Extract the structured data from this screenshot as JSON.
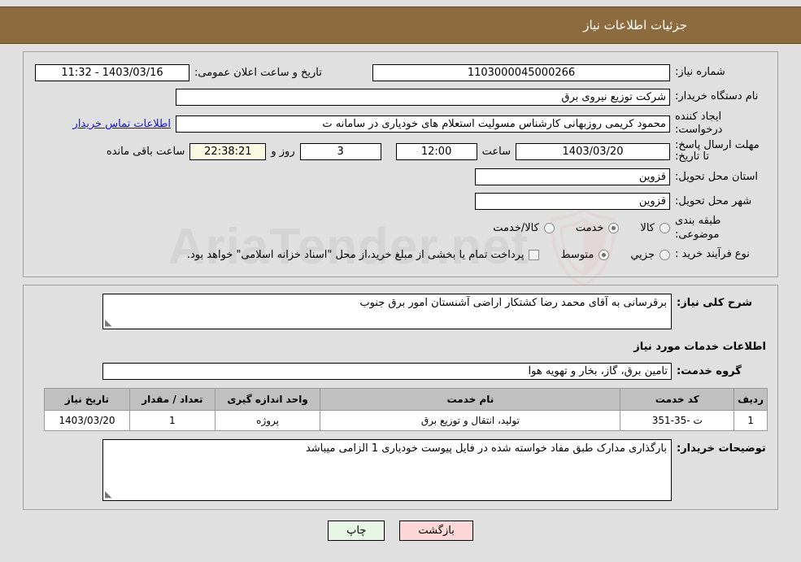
{
  "header": {
    "title": "جزئیات اطلاعات نیاز"
  },
  "form": {
    "need_number_label": "شماره نیاز:",
    "need_number_value": "1103000045000266",
    "announce_label": "تاریخ و ساعت اعلان عمومی:",
    "announce_value": "1403/03/16 - 11:32",
    "buyer_org_label": "نام دستگاه خریدار:",
    "buyer_org_value": "شرکت توزیع نیروی برق",
    "creator_label": "ایجاد کننده درخواست:",
    "creator_value": "محمود کریمی روزبهانی کارشناس  مسولیت استعلام های خودیاری در سامانه ت",
    "contact_link": "اطلاعات تماس خریدار",
    "deadline_label": "مهلت ارسال پاسخ: تا تاریخ:",
    "deadline_date": "1403/03/20",
    "hour_label": "ساعت",
    "hour_value": "12:00",
    "days_value": "3",
    "days_label": "روز و",
    "countdown_value": "22:38:21",
    "countdown_label": "ساعت باقی مانده",
    "province_label": "استان محل تحویل:",
    "province_value": "قزوین",
    "city_label": "شهر محل تحویل:",
    "city_value": "قزوین",
    "category_label": "طبقه بندی موضوعی:",
    "category_options": [
      {
        "label": "کالا",
        "selected": false
      },
      {
        "label": "خدمت",
        "selected": true
      },
      {
        "label": "کالا/خدمت",
        "selected": false
      }
    ],
    "process_label": "نوع فرآیند خرید :",
    "process_options": [
      {
        "label": "جزیي",
        "selected": false
      },
      {
        "label": "متوسط",
        "selected": true
      }
    ],
    "treasury_checked": false,
    "treasury_text": "پرداخت تمام یا بخشی از مبلغ خرید،از محل \"اسناد خزانه اسلامی\" خواهد بود."
  },
  "description": {
    "need_desc_label": "شرح کلی نیاز:",
    "need_desc_value": "برقرسانی به آقای محمد رضا کشتکار اراضی آشنستان امور برق جنوب",
    "section_title": "اطلاعات خدمات مورد نیاز",
    "service_group_label": "گروه خدمت:",
    "service_group_value": "تامین برق، گاز، بخار و تهویه هوا"
  },
  "table": {
    "headers": [
      "ردیف",
      "کد خدمت",
      "نام خدمت",
      "واحد اندازه گیری",
      "تعداد / مقدار",
      "تاریخ نیاز"
    ],
    "rows": [
      {
        "radif": "1",
        "code": "ت -35-351",
        "name": "تولید، انتقال و توزیع برق",
        "unit": "پروژه",
        "qty": "1",
        "date": "1403/03/20"
      }
    ]
  },
  "buyer_notes": {
    "label": "توضیحات خریدار:",
    "value": "بارگذاری مدارک طبق مفاد خواسته شده در فایل پیوست خودیاری 1 الزامی میباشد"
  },
  "footer": {
    "print_label": "چاپ",
    "back_label": "بازگشت"
  },
  "watermark": {
    "text": "AriaTender.net"
  }
}
